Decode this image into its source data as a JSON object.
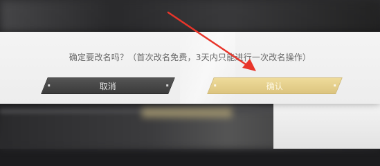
{
  "dialog": {
    "prompt": "确定要改名吗？（首次改名免费，3天内只能进行一次改名操作）",
    "cancel_label": "取消",
    "confirm_label": "确认"
  },
  "annotation": {
    "arrow_color": "#e8352a"
  },
  "colors": {
    "dialog_bg": "#f2f2f2",
    "cancel_bg": "#464646",
    "confirm_bg": "#e6d08c",
    "prompt_text": "#666666"
  },
  "icons": [
    "red-arrow-icon"
  ]
}
